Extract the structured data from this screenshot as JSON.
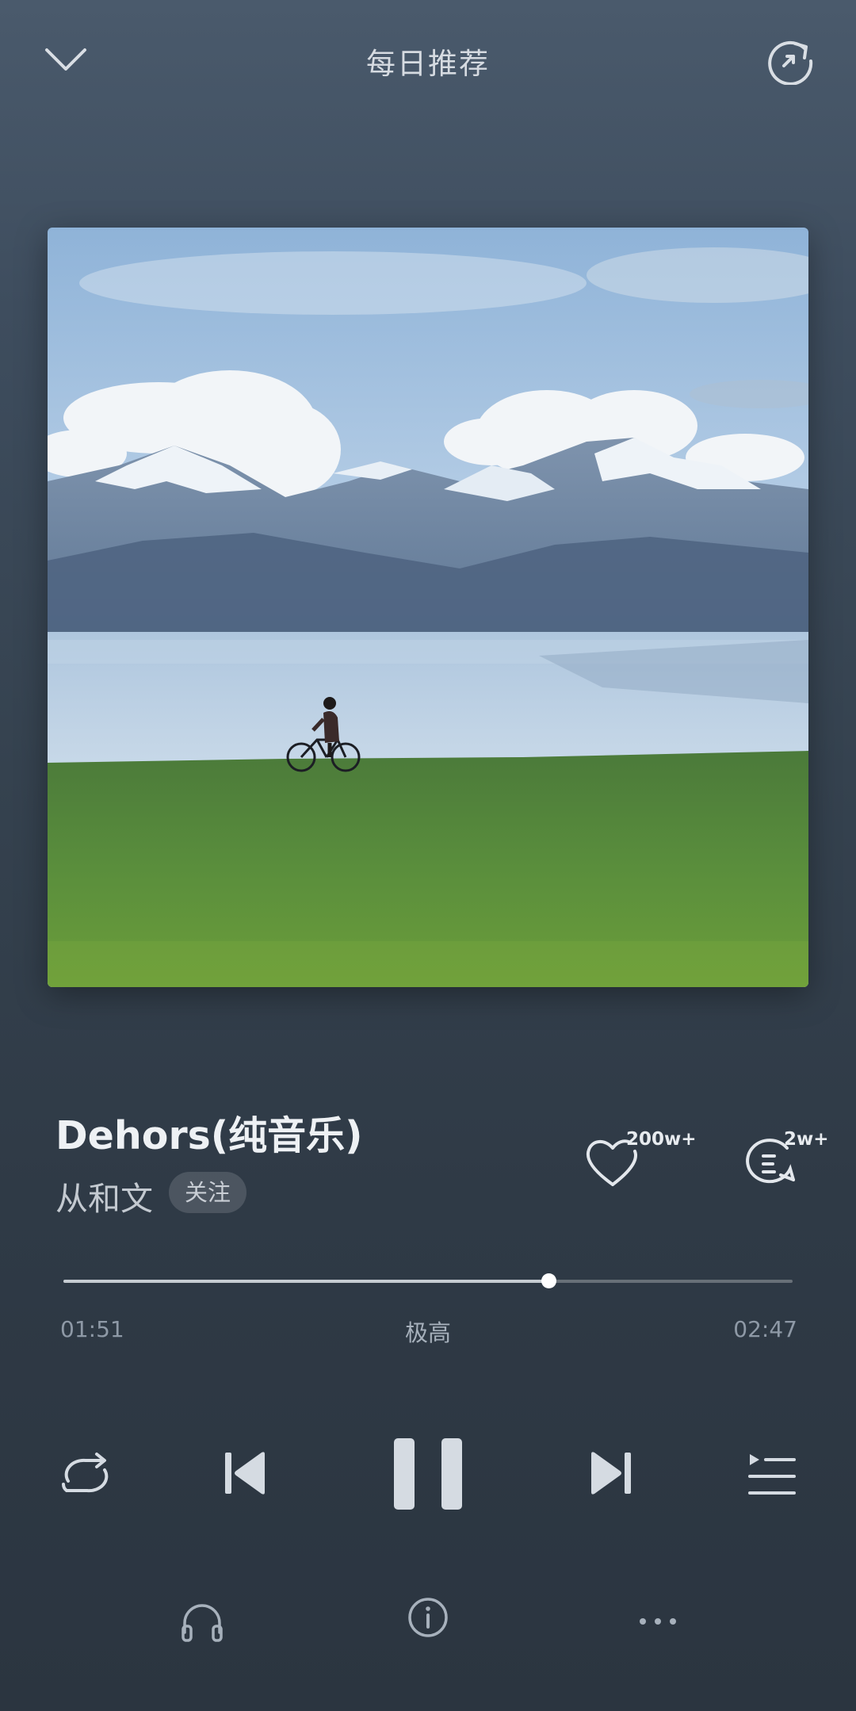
{
  "header": {
    "title": "每日推荐",
    "collapse_icon": "chevron-down-icon",
    "refresh_icon": "refresh-icon"
  },
  "cover": {
    "scene": "mountain-lake-cyclist"
  },
  "song": {
    "title": "Dehors(纯音乐)",
    "artist": "从和文",
    "follow_label": "关注",
    "like_count": "200w+",
    "comment_count": "2w+"
  },
  "progress": {
    "current": "01:51",
    "total": "02:47",
    "quality": "极高",
    "fraction": 0.6647
  },
  "controls": {
    "repeat_icon": "repeat-icon",
    "prev_icon": "skip-previous-icon",
    "pause_icon": "pause-icon",
    "next_icon": "skip-next-icon",
    "playlist_icon": "playlist-icon"
  },
  "bottom": {
    "headphones_icon": "headphones-icon",
    "info_icon": "info-icon",
    "more_icon": "more-icon"
  },
  "colors": {
    "background_top": "#4a5a6c",
    "background_bottom": "#2b3540",
    "text_primary": "#eef1f4",
    "text_secondary": "#8e99a6"
  }
}
